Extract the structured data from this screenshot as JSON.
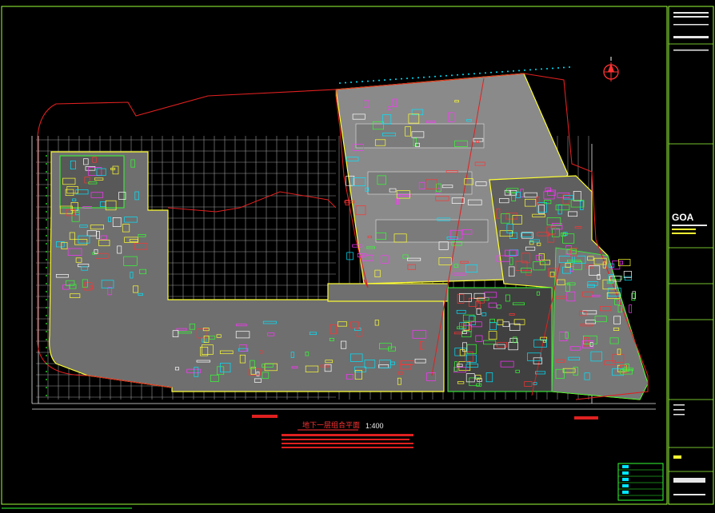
{
  "drawing": {
    "title": "地下一层组合平面",
    "scale": "1:400",
    "logo": "GOA"
  },
  "colors": {
    "background": "#000000",
    "frame": "#9cff3a",
    "boundary": "#e02020",
    "grid": "#e6e6e6",
    "hatch": "#8a8a8a",
    "cyan": "#00e5ff",
    "magenta": "#ff33ff",
    "yellow": "#ffff33",
    "green": "#33ff33"
  },
  "icons": {
    "north_arrow": "north-arrow-icon"
  }
}
